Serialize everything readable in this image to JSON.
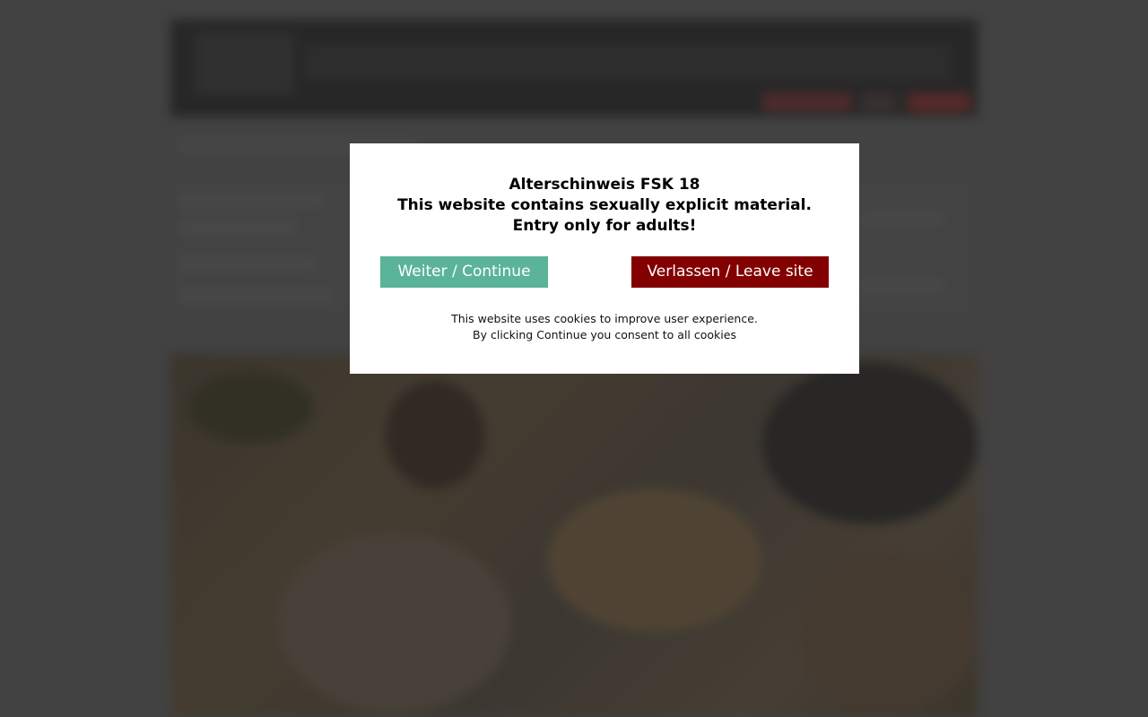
{
  "age_gate": {
    "heading_line1": "Alterschinweis FSK 18",
    "heading_line2": "This website contains sexually explicit material.",
    "heading_line3": "Entry only for adults!",
    "continue_label": "Weiter / Continue",
    "leave_label": "Verlassen / Leave site",
    "cookie_line1": "This website uses cookies to improve user experience.",
    "cookie_line2": "By clicking Continue you consent to all cookies"
  },
  "colors": {
    "continue_button": "#5bb39a",
    "leave_button": "#820000",
    "modal_background": "#ffffff",
    "page_overlay": "#454545"
  }
}
